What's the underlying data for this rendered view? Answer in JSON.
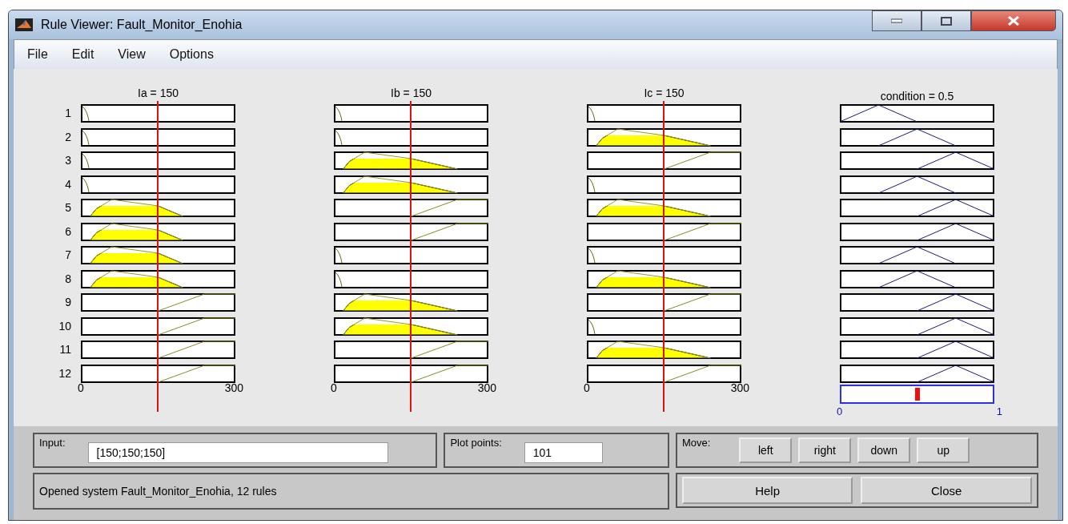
{
  "window": {
    "title": "Rule Viewer: Fault_Monitor_Enohia"
  },
  "menu": [
    "File",
    "Edit",
    "View",
    "Options"
  ],
  "inputs": [
    {
      "label": "Ia = 150",
      "axis_min": "0",
      "axis_max": "300"
    },
    {
      "label": "Ib = 150",
      "axis_min": "0",
      "axis_max": "300"
    },
    {
      "label": "Ic = 150",
      "axis_min": "0",
      "axis_max": "300"
    }
  ],
  "output": {
    "label": "condition = 0.5",
    "level": 0.5,
    "axis_min": "0",
    "axis_max": "1"
  },
  "rules": [
    {
      "number": "1",
      "inputs": [
        {
          "kind": "low"
        },
        {
          "kind": "low"
        },
        {
          "kind": "low"
        }
      ],
      "output": {
        "kind": "low"
      }
    },
    {
      "number": "2",
      "inputs": [
        {
          "kind": "low"
        },
        {
          "kind": "low"
        },
        {
          "kind": "medium"
        }
      ],
      "output": {
        "kind": "medium"
      }
    },
    {
      "number": "3",
      "inputs": [
        {
          "kind": "low"
        },
        {
          "kind": "medium"
        },
        {
          "kind": "high"
        }
      ],
      "output": {
        "kind": "high"
      }
    },
    {
      "number": "4",
      "inputs": [
        {
          "kind": "low"
        },
        {
          "kind": "medium"
        },
        {
          "kind": "low"
        }
      ],
      "output": {
        "kind": "medium"
      }
    },
    {
      "number": "5",
      "inputs": [
        {
          "kind": "medium"
        },
        {
          "kind": "high"
        },
        {
          "kind": "medium"
        }
      ],
      "output": {
        "kind": "high"
      }
    },
    {
      "number": "6",
      "inputs": [
        {
          "kind": "medium"
        },
        {
          "kind": "high"
        },
        {
          "kind": "high"
        }
      ],
      "output": {
        "kind": "high"
      }
    },
    {
      "number": "7",
      "inputs": [
        {
          "kind": "medium"
        },
        {
          "kind": "low"
        },
        {
          "kind": "low"
        }
      ],
      "output": {
        "kind": "medium"
      }
    },
    {
      "number": "8",
      "inputs": [
        {
          "kind": "medium"
        },
        {
          "kind": "low"
        },
        {
          "kind": "medium"
        }
      ],
      "output": {
        "kind": "medium"
      }
    },
    {
      "number": "9",
      "inputs": [
        {
          "kind": "high"
        },
        {
          "kind": "medium"
        },
        {
          "kind": "high"
        }
      ],
      "output": {
        "kind": "high"
      }
    },
    {
      "number": "10",
      "inputs": [
        {
          "kind": "high"
        },
        {
          "kind": "medium"
        },
        {
          "kind": "low"
        }
      ],
      "output": {
        "kind": "high"
      }
    },
    {
      "number": "11",
      "inputs": [
        {
          "kind": "high"
        },
        {
          "kind": "high"
        },
        {
          "kind": "medium"
        }
      ],
      "output": {
        "kind": "high"
      }
    },
    {
      "number": "12",
      "inputs": [
        {
          "kind": "high"
        },
        {
          "kind": "high"
        },
        {
          "kind": "high"
        }
      ],
      "output": {
        "kind": "high"
      }
    }
  ],
  "input_field": {
    "label": "Input:",
    "value": "[150;150;150]"
  },
  "plot_points": {
    "label": "Plot points:",
    "value": "101"
  },
  "move": {
    "label": "Move:",
    "buttons": [
      "left",
      "right",
      "down",
      "up"
    ]
  },
  "status": "Opened system Fault_Monitor_Enohia, 12 rules",
  "buttons": [
    "Help",
    "Close"
  ]
}
